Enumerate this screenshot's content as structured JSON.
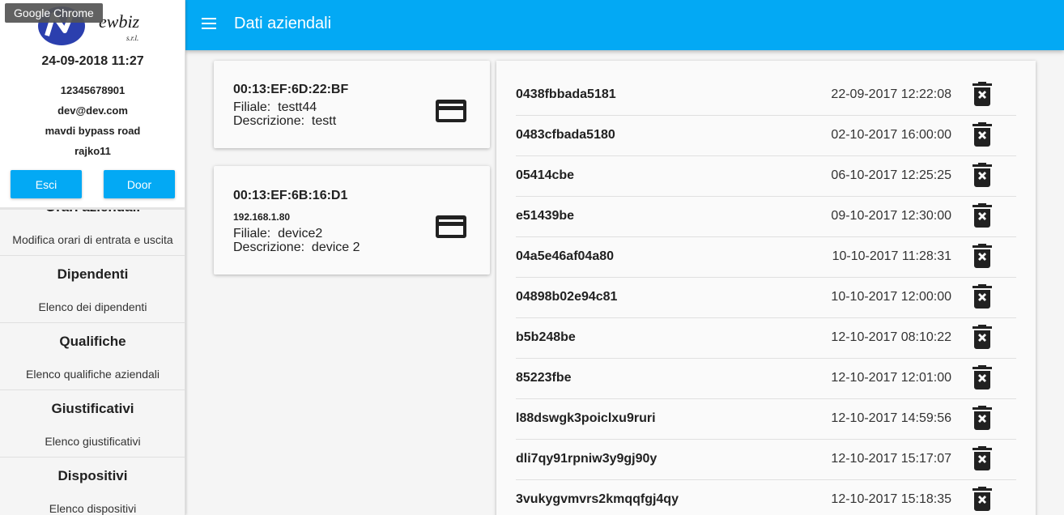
{
  "tooltip": "Google Chrome",
  "profile": {
    "logo_text": "ewbiz",
    "logo_sub": "s.r.l.",
    "datetime": "24-09-2018 11:27",
    "vat": "12345678901",
    "email": "dev@dev.com",
    "address": "mavdi bypass road",
    "username": "rajko11",
    "esci_label": "Esci",
    "door_label": "Door"
  },
  "menu": [
    {
      "title": "Orari aziendali",
      "subtitle": "Modifica orari di entrata e uscita"
    },
    {
      "title": "Dipendenti",
      "subtitle": "Elenco dei dipendenti"
    },
    {
      "title": "Qualifiche",
      "subtitle": "Elenco qualifiche aziendali"
    },
    {
      "title": "Giustificativi",
      "subtitle": "Elenco giustificativi"
    },
    {
      "title": "Dispositivi",
      "subtitle": "Elenco dispositivi"
    }
  ],
  "header": {
    "title": "Dati aziendali",
    "menu_icon": "hamburger-icon",
    "color": "#03a9f4"
  },
  "devices": [
    {
      "mac": "00:13:EF:6D:22:BF",
      "ip": "",
      "filiale_label": "Filiale:",
      "filiale": "testt44",
      "descr_label": "Descrizione:",
      "descrizione": "testt",
      "icon": "credit-card-icon"
    },
    {
      "mac": "00:13:EF:6B:16:D1",
      "ip": "192.168.1.80",
      "filiale_label": "Filiale:",
      "filiale": "device2",
      "descr_label": "Descrizione:",
      "descrizione": "device 2",
      "icon": "credit-card-icon"
    }
  ],
  "badges": [
    {
      "code": "0438fbbada5181",
      "date": "22-09-2017 12:22:08"
    },
    {
      "code": "0483cfbada5180",
      "date": "02-10-2017 16:00:00"
    },
    {
      "code": "05414cbe",
      "date": "06-10-2017 12:25:25"
    },
    {
      "code": "e51439be",
      "date": "09-10-2017 12:30:00"
    },
    {
      "code": "04a5e46af04a80",
      "date": "10-10-2017 11:28:31"
    },
    {
      "code": "04898b02e94c81",
      "date": "10-10-2017 12:00:00"
    },
    {
      "code": "b5b248be",
      "date": "12-10-2017 08:10:22"
    },
    {
      "code": "85223fbe",
      "date": "12-10-2017 12:01:00"
    },
    {
      "code": "l88dswgk3poiclxu9ruri",
      "date": "12-10-2017 14:59:56"
    },
    {
      "code": "dli7qy91rpniw3y9gj90y",
      "date": "12-10-2017 15:17:07"
    },
    {
      "code": "3vukygvmvrs2kmqqfgj4qy",
      "date": "12-10-2017 15:18:35"
    }
  ],
  "delete_icon": "delete-forever-icon"
}
